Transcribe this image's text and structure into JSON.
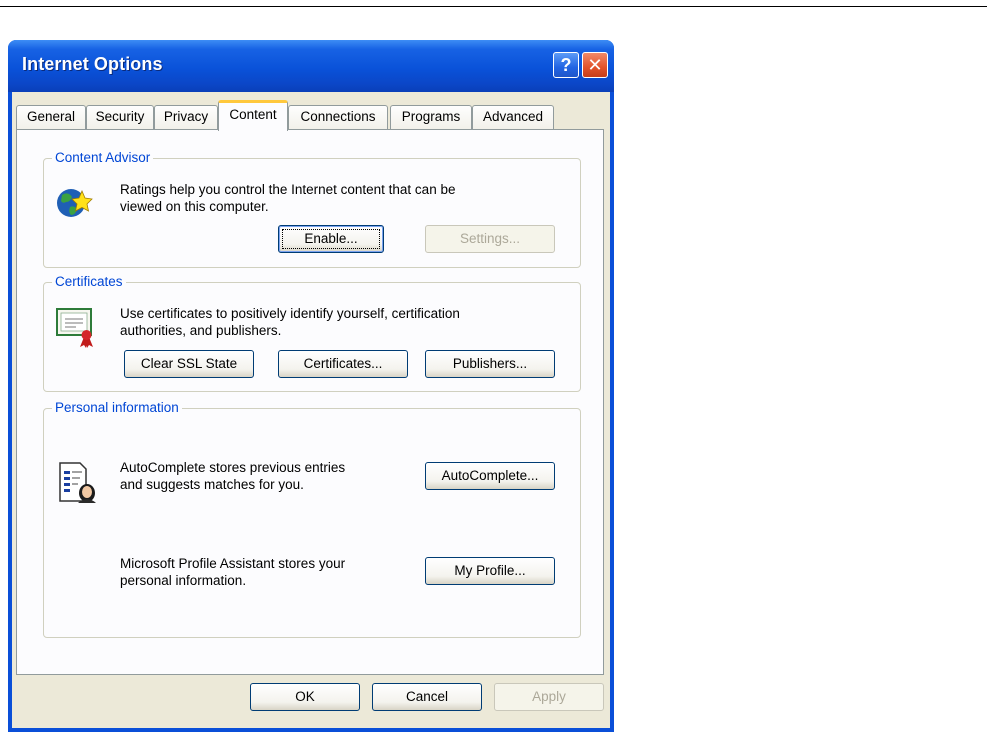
{
  "window": {
    "title": "Internet Options",
    "help_symbol": "?",
    "close_symbol": "✕"
  },
  "tabs": [
    {
      "label": "General"
    },
    {
      "label": "Security"
    },
    {
      "label": "Privacy"
    },
    {
      "label": "Content",
      "active": true
    },
    {
      "label": "Connections"
    },
    {
      "label": "Programs"
    },
    {
      "label": "Advanced"
    }
  ],
  "content_advisor": {
    "legend": "Content Advisor",
    "description_line1": "Ratings help you control the Internet content that can be",
    "description_line2": "viewed on this computer.",
    "enable_label": "Enable...",
    "settings_label": "Settings...",
    "icon": "globe-star-icon"
  },
  "certificates": {
    "legend": "Certificates",
    "description_line1": "Use certificates to positively identify yourself, certification",
    "description_line2": "authorities, and publishers.",
    "clear_ssl_label": "Clear SSL State",
    "certificates_label": "Certificates...",
    "publishers_label": "Publishers...",
    "icon": "certificate-icon"
  },
  "personal_information": {
    "legend": "Personal information",
    "autocomplete_line1": "AutoComplete stores previous entries",
    "autocomplete_line2": "and suggests matches for you.",
    "autocomplete_label": "AutoComplete...",
    "profile_line1": "Microsoft Profile Assistant stores your",
    "profile_line2": "personal information.",
    "my_profile_label": "My Profile...",
    "icon": "profile-document-icon"
  },
  "footer": {
    "ok_label": "OK",
    "cancel_label": "Cancel",
    "apply_label": "Apply"
  },
  "colors": {
    "title_bar": "#0a52d9",
    "dialog_face": "#ece9d8",
    "legend_text": "#0046d5",
    "active_tab_accent": "#ffc83c"
  }
}
